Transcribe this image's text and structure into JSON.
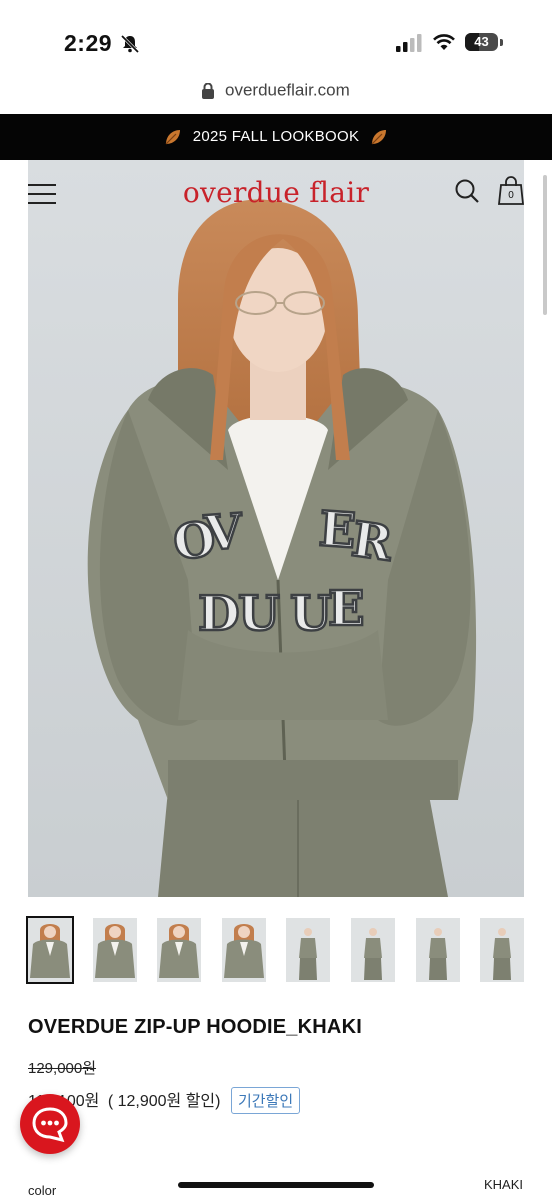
{
  "status_bar": {
    "time": "2:29",
    "battery": "43",
    "battery_level": 0.43
  },
  "browser": {
    "url": "overdueflair.com"
  },
  "promo": {
    "text": "2025 FALL LOOKBOOK"
  },
  "site": {
    "brand": "overdue flair",
    "cart_count": "0"
  },
  "product": {
    "name": "OVERDUE ZIP-UP HOODIE_KHAKI",
    "original_price": "129,000원",
    "sale_price": "116,100원",
    "discount": "( 12,900원 할인)",
    "badge": "기간할인",
    "thumbnail_count": 8,
    "active_thumbnail": 1
  },
  "option": {
    "label": "color",
    "value": "KHAKI"
  },
  "colors": {
    "brand_red": "#c8222a",
    "chat_red": "#d9161e",
    "badge_blue": "#3c78b8",
    "hoodie_khaki": "#8a8d7c"
  }
}
